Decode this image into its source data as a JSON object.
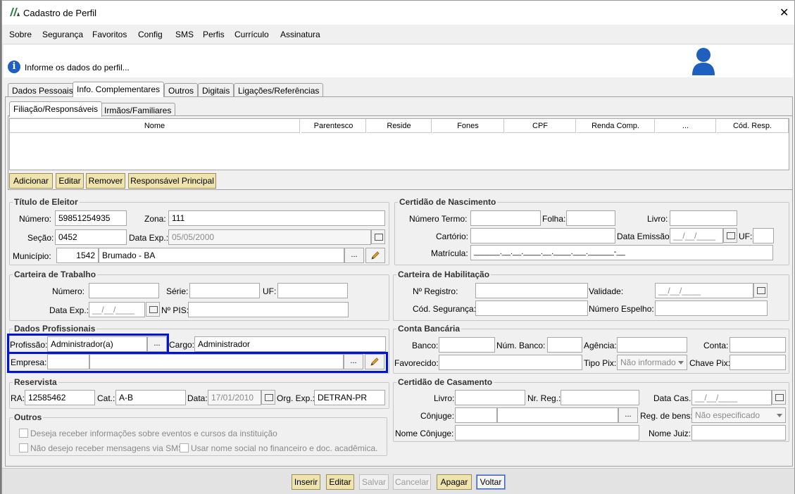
{
  "window": {
    "title": "Cadastro de Perfil",
    "close_glyph": "✕"
  },
  "menu": [
    "Sobre",
    "Segurança",
    "Favoritos",
    "Config",
    "SMS",
    "Perfis",
    "Currículo",
    "Assinatura"
  ],
  "banner": {
    "message": "Informe os dados do perfil..."
  },
  "tabs": [
    "Dados Pessoais",
    "Info. Complementares",
    "Outros",
    "Digitais",
    "Ligações/Referências"
  ],
  "subtabs": [
    "Filiação/Responsáveis",
    "Irmãos/Familiares"
  ],
  "grid": {
    "columns": [
      "Nome",
      "Parentesco",
      "Reside",
      "Fones",
      "CPF",
      "Renda Comp.",
      "...",
      "Cód. Resp."
    ],
    "buttons": [
      "Adicionar",
      "Editar",
      "Remover",
      "Responsável Principal"
    ]
  },
  "titulo_eleitor": {
    "title": "Título de Eleitor",
    "numero_label": "Número:",
    "numero": "59851254935",
    "zona_label": "Zona:",
    "zona": "111",
    "secao_label": "Seção:",
    "secao": "0452",
    "data_exp_label": "Data Exp.:",
    "data_exp": "05/05/2000",
    "municipio_label": "Município:",
    "municipio_code": "1542",
    "municipio": "Brumado - BA"
  },
  "certidao_nascimento": {
    "title": "Certidão de Nascimento",
    "numero_termo_label": "Número Termo:",
    "folha_label": "Folha:",
    "livro_label": "Livro:",
    "cartorio_label": "Cartório:",
    "data_emissao_label": "Data Emissão:",
    "data_emissao": "__/__/____",
    "uf_label": "UF:",
    "matricula_label": "Matrícula:",
    "matricula": "______.__.__.____.__.____.___.______-__"
  },
  "carteira_trabalho": {
    "title": "Carteira de Trabalho",
    "numero_label": "Número:",
    "serie_label": "Série:",
    "uf_label": "UF:",
    "data_exp_label": "Data Exp.:",
    "data_exp": "__/__/____",
    "pis_label": "Nº PIS:"
  },
  "carteira_habilitacao": {
    "title": "Carteira de Habilitação",
    "registro_label": "Nº Registro:",
    "validade_label": "Validade:",
    "validade": "__/__/____",
    "seguranca_label": "Cód. Segurança:",
    "espelho_label": "Número Espelho:"
  },
  "dados_profissionais": {
    "title": "Dados Profissionais",
    "profissao_label": "Profissão:",
    "profissao": "Administrador(a)",
    "cargo_label": "Cargo:",
    "cargo": "Administrador",
    "empresa_label": "Empresa:"
  },
  "conta_bancaria": {
    "title": "Conta Bancária",
    "banco_label": "Banco:",
    "num_banco_label": "Núm. Banco:",
    "agencia_label": "Agência:",
    "conta_label": "Conta:",
    "favorecido_label": "Favorecido:",
    "tipo_pix_label": "Tipo Pix:",
    "tipo_pix": "Não informado",
    "chave_pix_label": "Chave Pix:"
  },
  "reservista": {
    "title": "Reservista",
    "ra_label": "RA:",
    "ra": "12585462",
    "cat_label": "Cat.:",
    "cat": "A-B",
    "data_label": "Data:",
    "data": "17/01/2010",
    "org_label": "Org. Exp.:",
    "org": "DETRAN-PR"
  },
  "certidao_casamento": {
    "title": "Certidão de Casamento",
    "livro_label": "Livro:",
    "nr_reg_label": "Nr. Reg.:",
    "data_cas_label": "Data Cas.:",
    "data_cas": "__/__/____",
    "conjuge_label": "Cônjuge:",
    "reg_bens_label": "Reg. de bens:",
    "reg_bens": "Não especificado",
    "nome_conjuge_label": "Nome Cônjuge:",
    "nome_juiz_label": "Nome Juiz:"
  },
  "outros": {
    "title": "Outros",
    "chk1": "Deseja receber informações sobre eventos e cursos da instituição",
    "chk2": "Não desejo receber mensagens via SMS",
    "chk3": "Usar nome social no financeiro e doc. acadêmica."
  },
  "footer_buttons": [
    "Inserir",
    "Editar",
    "Salvar",
    "Cancelar",
    "Apagar",
    "Voltar"
  ],
  "ellipsis": "...",
  "colors": {
    "highlight": "#0015d0",
    "button": "#efe4ae",
    "accent_icon": "#1f5fbf"
  }
}
